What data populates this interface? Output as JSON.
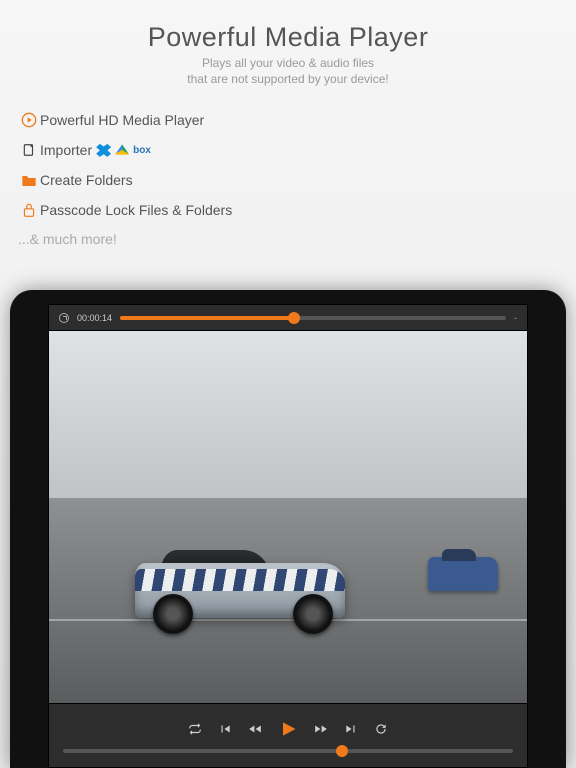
{
  "header": {
    "title": "Powerful Media Player",
    "subtitle_line1": "Plays all your video & audio files",
    "subtitle_line2": "that are not supported by your device!"
  },
  "features": {
    "hd_player": "Powerful HD Media Player",
    "importer": "Importer",
    "create_folders": "Create Folders",
    "passcode": "Passcode Lock Files & Folders"
  },
  "more_text": "...& much more!",
  "cloud": {
    "box_label": "box"
  },
  "player": {
    "time_elapsed": "00:00:14",
    "time_end": "-",
    "top_progress_pct": 45,
    "bottom_progress_pct": 62
  },
  "colors": {
    "accent": "#f07a1a"
  }
}
